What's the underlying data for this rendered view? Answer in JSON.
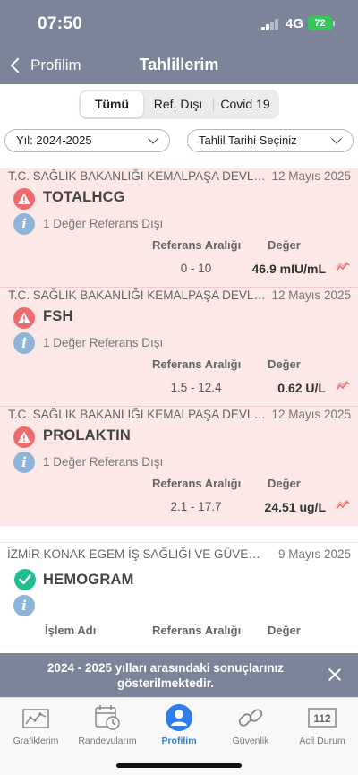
{
  "status_bar": {
    "time": "07:50",
    "network": "4G",
    "battery": "72"
  },
  "nav": {
    "back_label": "Profilim",
    "title": "Tahlillerim"
  },
  "segments": [
    "Tümü",
    "Ref. Dışı",
    "Covid 19"
  ],
  "filters": {
    "year": "Yıl: 2024-2025",
    "date": "Tahlil Tarihi Seçiniz"
  },
  "column_headers": {
    "reference": "Referans Aralığı",
    "value": "Değer",
    "operation": "İşlem Adı"
  },
  "results": [
    {
      "hospital": "T.C. SAĞLIK BAKANLIĞI KEMALPAŞA DEVLET HASTANESİ",
      "date": "12 Mayıs 2025",
      "test": "TOTALHCG",
      "status": "1 Değer Referans Dışı",
      "reference": "0 - 10",
      "value": "46.9 mIU/mL"
    },
    {
      "hospital": "T.C. SAĞLIK BAKANLIĞI KEMALPAŞA DEVLET HASTANESİ",
      "date": "12 Mayıs 2025",
      "test": "FSH",
      "status": "1 Değer Referans Dışı",
      "reference": "1.5 - 12.4",
      "value": "0.62 U/L"
    },
    {
      "hospital": "T.C. SAĞLIK BAKANLIĞI KEMALPAŞA DEVLET HASTANESİ",
      "date": "12 Mayıs 2025",
      "test": "PROLAKTIN",
      "status": "1 Değer Referans Dışı",
      "reference": "2.1 - 17.7",
      "value": "24.51 ug/L"
    }
  ],
  "normal_result": {
    "hospital": "İZMİR KONAK EGEM İŞ SAĞLIĞI VE GÜVENLİĞİ MERKEZİ",
    "date": "9 Mayıs 2025",
    "test": "HEMOGRAM"
  },
  "banner": {
    "text": "2024 - 2025 yılları arasındaki sonuçlarınız gösterilmektedir."
  },
  "tabs": [
    {
      "label": "Grafiklerim",
      "icon": "chart-icon"
    },
    {
      "label": "Randevularım",
      "icon": "calendar-icon"
    },
    {
      "label": "Profilim",
      "icon": "person-icon"
    },
    {
      "label": "Güvenlik",
      "icon": "link-icon"
    },
    {
      "label": "Acil Durum",
      "icon": "emergency-112-icon",
      "badge": "112"
    }
  ],
  "colors": {
    "header": "#7c8499",
    "abnormal_bg": "#fde8e8",
    "warning": "#ee6b6b",
    "ok": "#1fbf8f",
    "info": "#8fb4d9",
    "active_tab": "#2d7ee8"
  }
}
